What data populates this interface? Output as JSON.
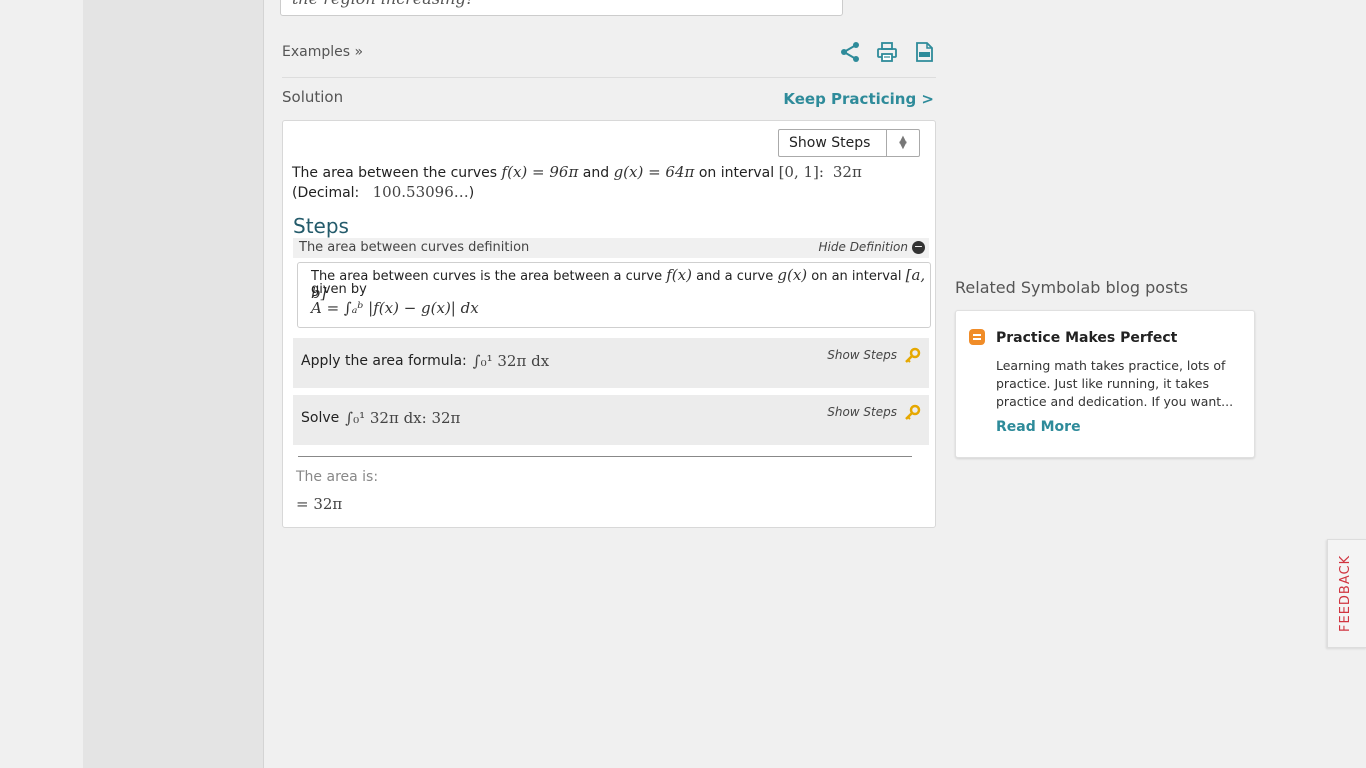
{
  "top_input": {
    "text": "the region increasing?"
  },
  "examples_link": "Examples »",
  "toolbar": {
    "share_icon": "share-icon",
    "print_icon": "print-icon",
    "pdf_icon": "pdf-icon",
    "accent": "#2e8b9a"
  },
  "solution": {
    "label": "Solution",
    "keep_practicing": "Keep Practicing >",
    "steps_select": "Show Steps",
    "answer": {
      "prefix": "The area between the curves",
      "f": "f(x) = 96π",
      "and": "and",
      "g": "g(x) = 64π",
      "on_interval": "on interval",
      "interval": "[0, 1]:",
      "result": "32π",
      "decimal_label": "(Decimal:",
      "decimal_value": "100.53096…",
      "decimal_close": ")"
    },
    "steps_title": "Steps",
    "definition": {
      "header": "The area between curves definition",
      "hide_label": "Hide Definition",
      "line1_a": "The area between curves is the area between a curve",
      "line1_f": "f(x)",
      "line1_b": "and a curve",
      "line1_g": "g(x)",
      "line1_c": "on an interval",
      "line1_i": "[a, b]",
      "line2": "given by",
      "formula": "A = ∫ₐᵇ |f(x) − g(x)| dx"
    },
    "steps": [
      {
        "text": "Apply the area formula:",
        "math": "∫₀¹ 32π dx",
        "show": "Show Steps"
      },
      {
        "text": "Solve",
        "math": "∫₀¹ 32π dx:   32π",
        "show": "Show Steps"
      }
    ],
    "area_label": "The area is:",
    "area_value": "= 32π"
  },
  "related": {
    "title": "Related Symbolab blog posts",
    "post": {
      "title": "Practice Makes Perfect",
      "text": "Learning math takes practice, lots of practice. Just like running, it takes practice and dedication. If you want...",
      "read_more": "Read More"
    }
  },
  "feedback": "FEEDBACK"
}
